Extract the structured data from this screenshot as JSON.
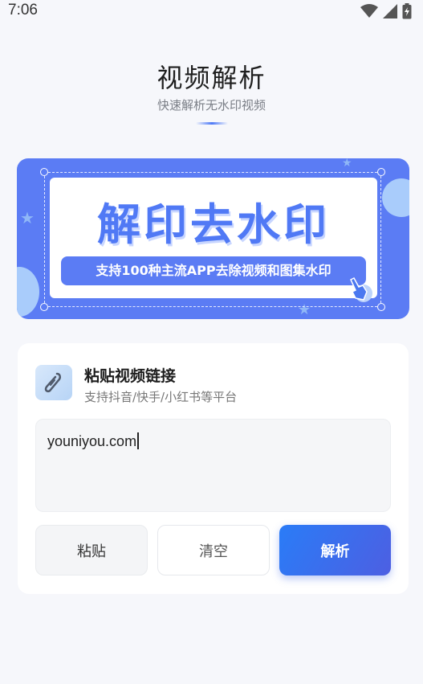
{
  "status_bar": {
    "time": "7:06",
    "icons": [
      "wifi-icon",
      "signal-icon",
      "battery-charging-icon"
    ]
  },
  "header": {
    "title": "视频解析",
    "subtitle": "快速解析无水印视频"
  },
  "banner": {
    "headline": "解印去水印",
    "tagline": "支持100种主流APP去除视频和图集水印",
    "accent_color": "#5b7cf4"
  },
  "card": {
    "icon": "link-icon",
    "title": "粘贴视频链接",
    "subtitle": "支持抖音/快手/小红书等平台",
    "input_value": "youniyou.com",
    "buttons": {
      "paste_label": "粘贴",
      "clear_label": "清空",
      "parse_label": "解析"
    }
  }
}
